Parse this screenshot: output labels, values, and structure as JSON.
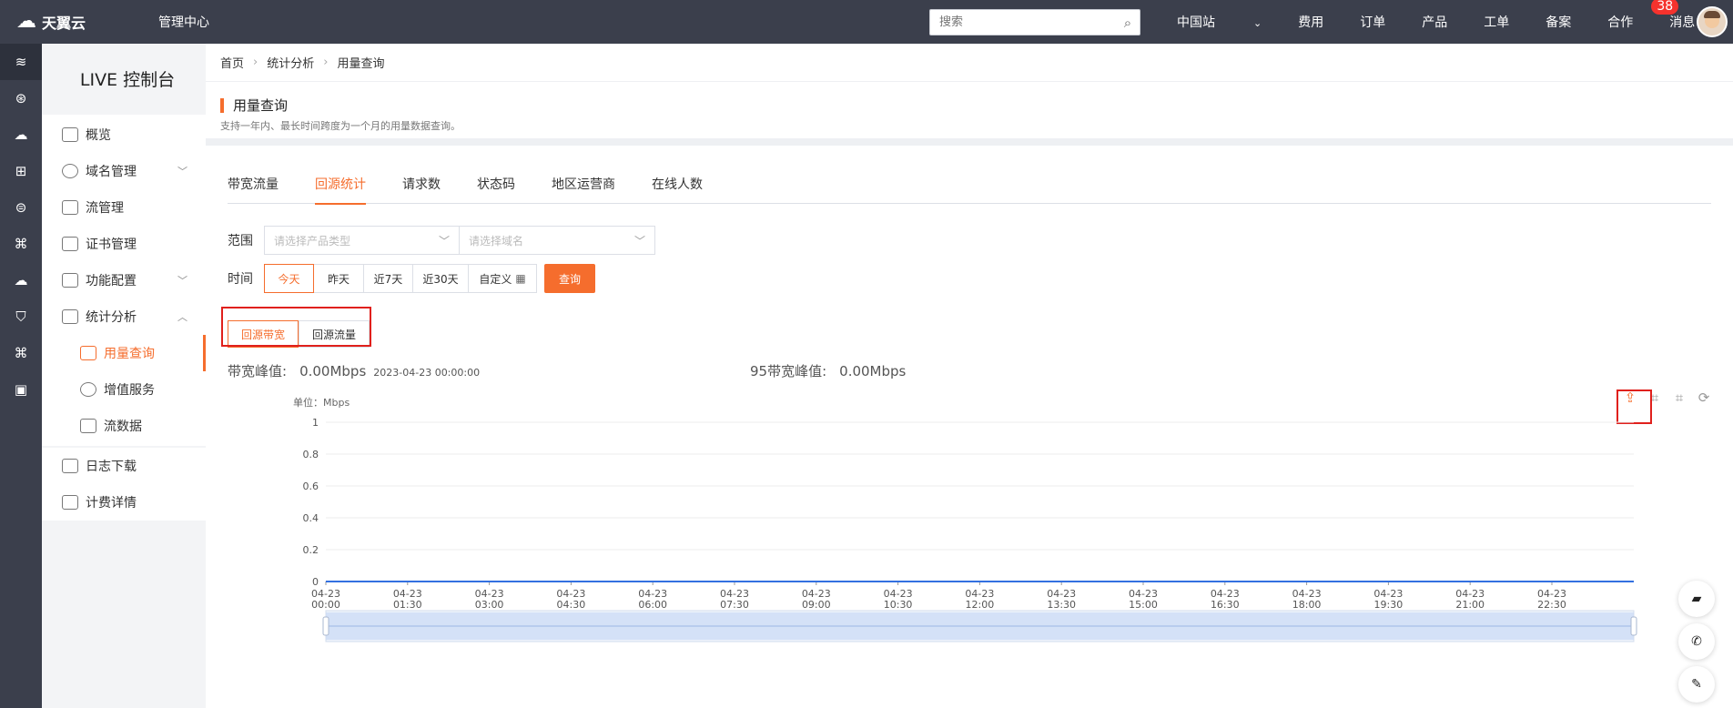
{
  "topbar": {
    "brand": "天翼云",
    "mgmt": "管理中心",
    "search_placeholder": "搜索",
    "nav": [
      "中国站",
      "费用",
      "订单",
      "产品",
      "工单",
      "备案",
      "合作",
      "消息"
    ],
    "msg_count": "38",
    "region_suffix": "⌄"
  },
  "sidebar": {
    "title": "LIVE 控制台",
    "items": [
      "概览",
      "域名管理",
      "流管理",
      "证书管理",
      "功能配置",
      "统计分析"
    ],
    "sub_items": [
      "用量查询",
      "增值服务",
      "流数据"
    ],
    "tail_items": [
      "日志下载",
      "计费详情"
    ]
  },
  "breadcrumb": [
    "首页",
    "统计分析",
    "用量查询"
  ],
  "page": {
    "title": "用量查询",
    "desc": "支持一年内、最长时间跨度为一个月的用量数据查询。"
  },
  "tabs": [
    "带宽流量",
    "回源统计",
    "请求数",
    "状态码",
    "地区运营商",
    "在线人数"
  ],
  "filters": {
    "scope_label": "范围",
    "product_placeholder": "请选择产品类型",
    "domain_placeholder": "请选择域名",
    "time_label": "时间",
    "time_options": [
      "今天",
      "昨天",
      "近7天",
      "近30天",
      "自定义"
    ],
    "query_button": "查询"
  },
  "subtabs": [
    "回源带宽",
    "回源流量"
  ],
  "peaks": {
    "bw_label": "带宽峰值:",
    "bw_value": "0.00Mbps",
    "bw_time": "2023-04-23 00:00:00",
    "p95_label": "95带宽峰值:",
    "p95_value": "0.00Mbps"
  },
  "chart_data": {
    "type": "line",
    "unit_label": "单位：Mbps",
    "y_ticks": [
      "0",
      "0.2",
      "0.4",
      "0.6",
      "0.8",
      "1"
    ],
    "ylim": [
      0,
      1
    ],
    "x_ticks": [
      [
        "04-23",
        "00:00"
      ],
      [
        "04-23",
        "01:30"
      ],
      [
        "04-23",
        "03:00"
      ],
      [
        "04-23",
        "04:30"
      ],
      [
        "04-23",
        "06:00"
      ],
      [
        "04-23",
        "07:30"
      ],
      [
        "04-23",
        "09:00"
      ],
      [
        "04-23",
        "10:30"
      ],
      [
        "04-23",
        "12:00"
      ],
      [
        "04-23",
        "13:30"
      ],
      [
        "04-23",
        "15:00"
      ],
      [
        "04-23",
        "16:30"
      ],
      [
        "04-23",
        "18:00"
      ],
      [
        "04-23",
        "19:30"
      ],
      [
        "04-23",
        "21:00"
      ],
      [
        "04-23",
        "22:30"
      ]
    ],
    "series": [
      {
        "values": [
          0,
          0,
          0,
          0,
          0,
          0,
          0,
          0,
          0,
          0,
          0,
          0,
          0,
          0,
          0,
          0,
          0
        ]
      }
    ],
    "line_color": "#3370e0",
    "grid": true
  },
  "colors": {
    "accent": "#f56d2d",
    "highlight": "#e0201c",
    "topbar": "#3b3f4c"
  }
}
